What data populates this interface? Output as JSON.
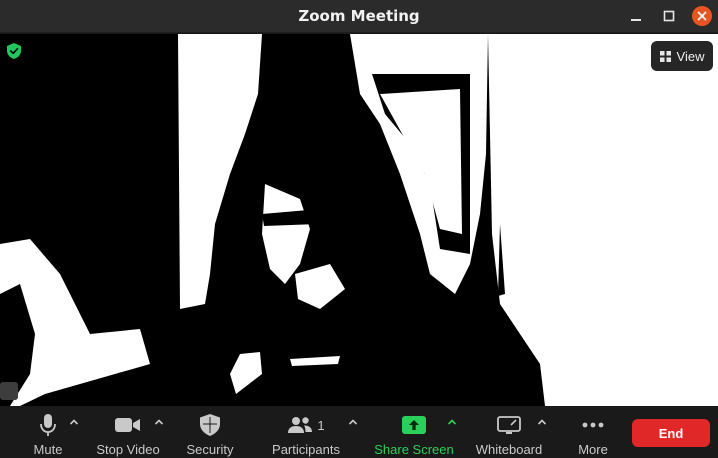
{
  "window": {
    "title": "Zoom Meeting"
  },
  "video": {
    "view_label": "View"
  },
  "toolbar": {
    "mute_label": "Mute",
    "stop_video_label": "Stop Video",
    "security_label": "Security",
    "participants_label": "Participants",
    "participants_count": "1",
    "share_screen_label": "Share Screen",
    "whiteboard_label": "Whiteboard",
    "more_label": "More",
    "end_label": "End"
  },
  "colors": {
    "share_green": "#2bd05b",
    "end_red": "#e02828",
    "close_orange": "#e95420",
    "secure_green": "#23c55e"
  },
  "icons": [
    "shield-check-icon",
    "grid-view-icon",
    "mic-icon",
    "video-camera-icon",
    "security-shield-icon",
    "participants-icon",
    "share-arrow-icon",
    "whiteboard-icon",
    "more-dots-icon",
    "close-icon",
    "minimize-icon",
    "maximize-icon",
    "chevron-up-icon"
  ]
}
